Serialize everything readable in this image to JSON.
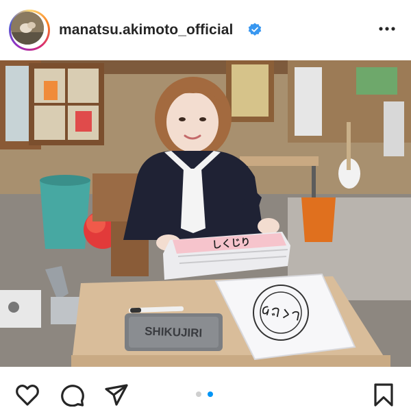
{
  "post": {
    "username": "manatsu.akimoto_official",
    "verified": true,
    "more_icon": "more-horizontal-icon",
    "avatar_icon": "profile-avatar",
    "image": {
      "props": {
        "tin_label": "SHIKUJIRI",
        "folder_label": "しくじり"
      }
    },
    "carousel": {
      "count": 2,
      "active_index": 2
    }
  },
  "actions": {
    "like_icon": "heart-icon",
    "comment_icon": "comment-icon",
    "share_icon": "send-icon",
    "save_icon": "bookmark-icon"
  },
  "colors": {
    "verified_blue": "#3897f0",
    "active_dot": "#0095f6",
    "inactive_dot": "#cfcfcf",
    "text": "#262626"
  }
}
